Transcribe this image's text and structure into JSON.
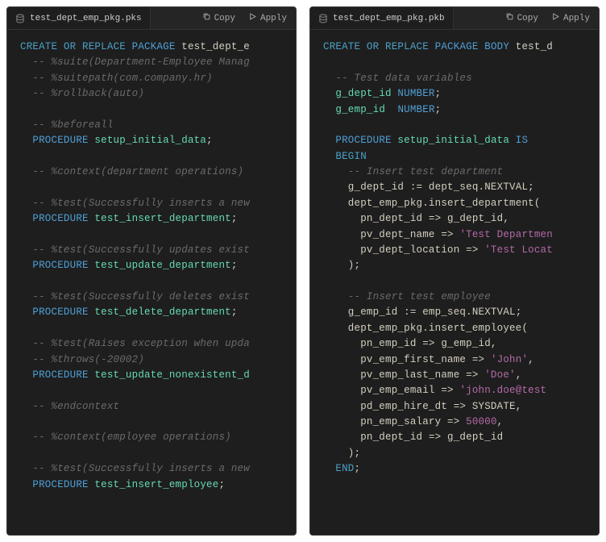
{
  "left": {
    "filename": "test_dept_emp_pkg.pks",
    "actions": {
      "copy": "Copy",
      "apply": "Apply"
    },
    "code": [
      [
        [
          "kw",
          "CREATE"
        ],
        [
          "plain",
          " "
        ],
        [
          "kw",
          "OR"
        ],
        [
          "plain",
          " "
        ],
        [
          "kw",
          "REPLACE"
        ],
        [
          "plain",
          " "
        ],
        [
          "kw2",
          "PACKAGE"
        ],
        [
          "plain",
          " test_dept_e"
        ]
      ],
      [
        [
          "plain",
          "  "
        ],
        [
          "cm",
          "-- %suite(Department-Employee Manag"
        ]
      ],
      [
        [
          "plain",
          "  "
        ],
        [
          "cm",
          "-- %suitepath(com.company.hr)"
        ]
      ],
      [
        [
          "plain",
          "  "
        ],
        [
          "cm",
          "-- %rollback(auto)"
        ]
      ],
      [],
      [
        [
          "plain",
          "  "
        ],
        [
          "cm",
          "-- %beforeall"
        ]
      ],
      [
        [
          "plain",
          "  "
        ],
        [
          "kw2",
          "PROCEDURE"
        ],
        [
          "plain",
          " "
        ],
        [
          "id",
          "setup_initial_data"
        ],
        [
          "plain",
          ";"
        ]
      ],
      [],
      [
        [
          "plain",
          "  "
        ],
        [
          "cm",
          "-- %context(department operations)"
        ]
      ],
      [],
      [
        [
          "plain",
          "  "
        ],
        [
          "cm",
          "-- %test(Successfully inserts a new"
        ]
      ],
      [
        [
          "plain",
          "  "
        ],
        [
          "kw2",
          "PROCEDURE"
        ],
        [
          "plain",
          " "
        ],
        [
          "id",
          "test_insert_department"
        ],
        [
          "plain",
          ";"
        ]
      ],
      [],
      [
        [
          "plain",
          "  "
        ],
        [
          "cm",
          "-- %test(Successfully updates exist"
        ]
      ],
      [
        [
          "plain",
          "  "
        ],
        [
          "kw2",
          "PROCEDURE"
        ],
        [
          "plain",
          " "
        ],
        [
          "id",
          "test_update_department"
        ],
        [
          "plain",
          ";"
        ]
      ],
      [],
      [
        [
          "plain",
          "  "
        ],
        [
          "cm",
          "-- %test(Successfully deletes exist"
        ]
      ],
      [
        [
          "plain",
          "  "
        ],
        [
          "kw2",
          "PROCEDURE"
        ],
        [
          "plain",
          " "
        ],
        [
          "id",
          "test_delete_department"
        ],
        [
          "plain",
          ";"
        ]
      ],
      [],
      [
        [
          "plain",
          "  "
        ],
        [
          "cm",
          "-- %test(Raises exception when upda"
        ]
      ],
      [
        [
          "plain",
          "  "
        ],
        [
          "cm",
          "-- %throws(-20002)"
        ]
      ],
      [
        [
          "plain",
          "  "
        ],
        [
          "kw2",
          "PROCEDURE"
        ],
        [
          "plain",
          " "
        ],
        [
          "id",
          "test_update_nonexistent_d"
        ]
      ],
      [],
      [
        [
          "plain",
          "  "
        ],
        [
          "cm",
          "-- %endcontext"
        ]
      ],
      [],
      [
        [
          "plain",
          "  "
        ],
        [
          "cm",
          "-- %context(employee operations)"
        ]
      ],
      [],
      [
        [
          "plain",
          "  "
        ],
        [
          "cm",
          "-- %test(Successfully inserts a new"
        ]
      ],
      [
        [
          "plain",
          "  "
        ],
        [
          "kw2",
          "PROCEDURE"
        ],
        [
          "plain",
          " "
        ],
        [
          "id",
          "test_insert_employee"
        ],
        [
          "plain",
          ";"
        ]
      ]
    ]
  },
  "right": {
    "filename": "test_dept_emp_pkg.pkb",
    "actions": {
      "copy": "Copy",
      "apply": "Apply"
    },
    "code": [
      [
        [
          "kw",
          "CREATE"
        ],
        [
          "plain",
          " "
        ],
        [
          "kw",
          "OR"
        ],
        [
          "plain",
          " "
        ],
        [
          "kw",
          "REPLACE"
        ],
        [
          "plain",
          " "
        ],
        [
          "kw2",
          "PACKAGE BODY"
        ],
        [
          "plain",
          " test_d"
        ]
      ],
      [],
      [
        [
          "plain",
          "  "
        ],
        [
          "cm",
          "-- Test data variables"
        ]
      ],
      [
        [
          "plain",
          "  "
        ],
        [
          "id",
          "g_dept_id"
        ],
        [
          "plain",
          " "
        ],
        [
          "kw2",
          "NUMBER"
        ],
        [
          "plain",
          ";"
        ]
      ],
      [
        [
          "plain",
          "  "
        ],
        [
          "id",
          "g_emp_id"
        ],
        [
          "plain",
          "  "
        ],
        [
          "kw2",
          "NUMBER"
        ],
        [
          "plain",
          ";"
        ]
      ],
      [],
      [
        [
          "plain",
          "  "
        ],
        [
          "kw2",
          "PROCEDURE"
        ],
        [
          "plain",
          " "
        ],
        [
          "id",
          "setup_initial_data"
        ],
        [
          "plain",
          " "
        ],
        [
          "kw2",
          "IS"
        ]
      ],
      [
        [
          "plain",
          "  "
        ],
        [
          "kw",
          "BEGIN"
        ]
      ],
      [
        [
          "plain",
          "    "
        ],
        [
          "cm",
          "-- Insert test department"
        ]
      ],
      [
        [
          "plain",
          "    g_dept_id := dept_seq.NEXTVAL;"
        ]
      ],
      [
        [
          "plain",
          "    dept_emp_pkg.insert_department("
        ]
      ],
      [
        [
          "plain",
          "      pn_dept_id => g_dept_id,"
        ]
      ],
      [
        [
          "plain",
          "      pv_dept_name => "
        ],
        [
          "str",
          "'Test Departmen"
        ]
      ],
      [
        [
          "plain",
          "      pv_dept_location => "
        ],
        [
          "str",
          "'Test Locat"
        ]
      ],
      [
        [
          "plain",
          "    );"
        ]
      ],
      [],
      [
        [
          "plain",
          "    "
        ],
        [
          "cm",
          "-- Insert test employee"
        ]
      ],
      [
        [
          "plain",
          "    g_emp_id := emp_seq.NEXTVAL;"
        ]
      ],
      [
        [
          "plain",
          "    dept_emp_pkg.insert_employee("
        ]
      ],
      [
        [
          "plain",
          "      pn_emp_id => g_emp_id,"
        ]
      ],
      [
        [
          "plain",
          "      pv_emp_first_name => "
        ],
        [
          "str",
          "'John'"
        ],
        [
          "plain",
          ","
        ]
      ],
      [
        [
          "plain",
          "      pv_emp_last_name => "
        ],
        [
          "str",
          "'Doe'"
        ],
        [
          "plain",
          ","
        ]
      ],
      [
        [
          "plain",
          "      pv_emp_email => "
        ],
        [
          "str",
          "'john.doe@test"
        ]
      ],
      [
        [
          "plain",
          "      pd_emp_hire_dt => SYSDATE,"
        ]
      ],
      [
        [
          "plain",
          "      pn_emp_salary => "
        ],
        [
          "num",
          "50000"
        ],
        [
          "plain",
          ","
        ]
      ],
      [
        [
          "plain",
          "      pn_dept_id => g_dept_id"
        ]
      ],
      [
        [
          "plain",
          "    );"
        ]
      ],
      [
        [
          "plain",
          "  "
        ],
        [
          "kw",
          "END"
        ],
        [
          "plain",
          ";"
        ]
      ]
    ]
  }
}
